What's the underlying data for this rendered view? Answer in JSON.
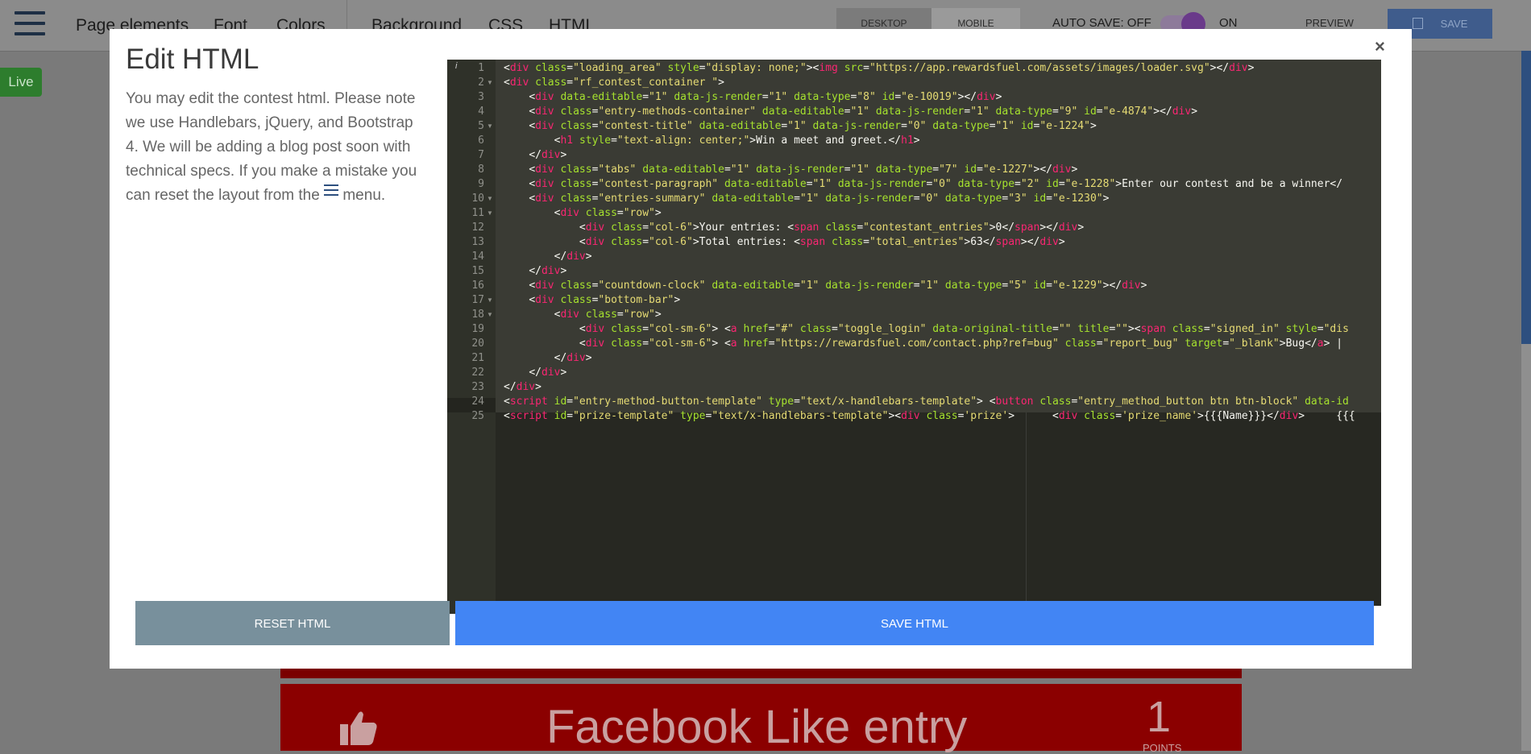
{
  "topbar": {
    "nav": [
      "Page elements",
      "Font",
      "Colors",
      "Background",
      "CSS",
      "HTML"
    ],
    "device_desktop": "DESKTOP",
    "device_mobile": "MOBILE",
    "autosave": "AUTO SAVE: OFF",
    "on": "ON",
    "preview": "PREVIEW",
    "save": "SAVE"
  },
  "live_badge": "Live",
  "background_entry": {
    "title": "Facebook Like entry",
    "points_value": "1",
    "points_label": "POINTS"
  },
  "modal": {
    "title": "Edit HTML",
    "description": "You may edit the contest html. Please note we use Handlebars, jQuery, and Bootstrap 4. We will be adding a blog post soon with technical specs. If you make a mistake you can reset the layout from the",
    "description_end": "menu.",
    "close": "×",
    "reset_button": "RESET HTML",
    "save_button": "SAVE HTML"
  },
  "colors": {
    "modal_bg": "#ffffff",
    "editor_bg": "#272822",
    "reset_bg": "#78909c",
    "save_bg": "#4285f4",
    "live_green": "#2d7d2d",
    "entry_red": "#8b0000"
  },
  "code": {
    "line_numbers": [
      "1",
      "2",
      "3",
      "4",
      "5",
      "6",
      "7",
      "8",
      "9",
      "10",
      "11",
      "12",
      "13",
      "14",
      "15",
      "16",
      "17",
      "18",
      "19",
      "20",
      "21",
      "22",
      "23",
      "24",
      "25"
    ],
    "lines": [
      "<div class=\"loading_area\" style=\"display: none;\"><img src=\"https://app.rewardsfuel.com/assets/images/loader.svg\"></div>",
      "<div class=\"rf_contest_container \">",
      "    <div data-editable=\"1\" data-js-render=\"1\" data-type=\"8\" id=\"e-10019\"></div>",
      "    <div class=\"entry-methods-container\" data-editable=\"1\" data-js-render=\"1\" data-type=\"9\" id=\"e-4874\"></div>",
      "    <div class=\"contest-title\" data-editable=\"1\" data-js-render=\"0\" data-type=\"1\" id=\"e-1224\">",
      "        <h1 style=\"text-align: center;\">Win a meet and greet.</h1>",
      "    </div>",
      "    <div class=\"tabs\" data-editable=\"1\" data-js-render=\"1\" data-type=\"7\" id=\"e-1227\"></div>",
      "    <div class=\"contest-paragraph\" data-editable=\"1\" data-js-render=\"0\" data-type=\"2\" id=\"e-1228\">Enter our contest and be a winner</",
      "    <div class=\"entries-summary\" data-editable=\"1\" data-js-render=\"0\" data-type=\"3\" id=\"e-1230\">",
      "        <div class=\"row\">",
      "            <div class=\"col-6\">Your entries: <span class=\"contestant_entries\">0</span></div>",
      "            <div class=\"col-6\">Total entries: <span class=\"total_entries\">63</span></div>",
      "        </div>",
      "    </div>",
      "    <div class=\"countdown-clock\" data-editable=\"1\" data-js-render=\"1\" data-type=\"5\" id=\"e-1229\"></div>",
      "    <div class=\"bottom-bar\">",
      "        <div class=\"row\">",
      "            <div class=\"col-sm-6\"> <a href=\"#\" class=\"toggle_login\" data-original-title=\"\" title=\"\"><span class=\"signed_in\" style=\"dis",
      "            <div class=\"col-sm-6\"> <a href=\"https://rewardsfuel.com/contact.php?ref=bug\" class=\"report_bug\" target=\"_blank\">Bug</a> |",
      "        </div>",
      "    </div>",
      "</div>",
      "<script id=\"entry-method-button-template\" type=\"text/x-handlebars-template\"> <button class=\"entry_method_button btn btn-block\" data-id",
      "<script id=\"prize-template\" type=\"text/x-handlebars-template\"><div class='prize'>      <div class='prize_name'>{{{Name}}}</div>     {{{"
    ],
    "folded_lines": [
      2,
      5,
      10,
      11,
      17,
      18
    ]
  }
}
